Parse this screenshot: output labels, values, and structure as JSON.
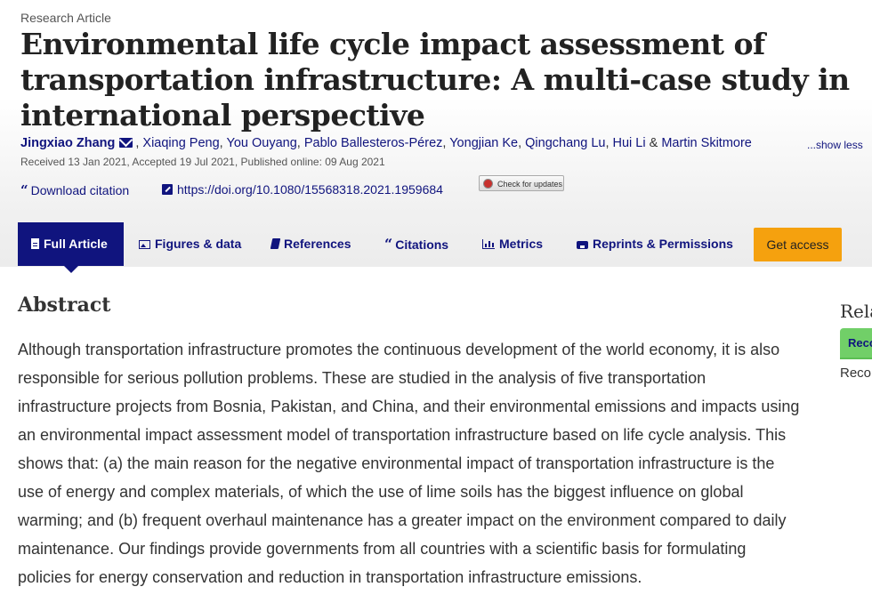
{
  "article": {
    "type": "Research Article",
    "title": "Environmental life cycle impact assessment of transportation infrastructure: A multi-case study in international perspective",
    "authors": [
      "Jingxiao Zhang",
      "Xiaqing Peng",
      "You Ouyang",
      "Pablo Ballesteros-Pérez",
      "Yongjian Ke",
      "Qingchang Lu",
      "Hui Li",
      "Martin Skitmore"
    ],
    "author_separator": ",",
    "author_last_separator": "&",
    "show_less": "...show less",
    "dates": "Received 13 Jan 2021, Accepted 19 Jul 2021, Published online: 09 Aug 2021"
  },
  "links": {
    "download_citation": "Download citation",
    "doi": "https://doi.org/10.1080/15568318.2021.1959684",
    "check_updates": "Check for updates"
  },
  "tabs": [
    {
      "label": "Full Article",
      "icon": "document-icon",
      "active": true
    },
    {
      "label": "Figures & data",
      "icon": "image-icon",
      "active": false
    },
    {
      "label": "References",
      "icon": "book-icon",
      "active": false
    },
    {
      "label": "Citations",
      "icon": "quote-icon",
      "active": false
    },
    {
      "label": "Metrics",
      "icon": "bar-chart-icon",
      "active": false
    },
    {
      "label": "Reprints & Permissions",
      "icon": "print-icon",
      "active": false
    }
  ],
  "get_access": "Get access",
  "abstract": {
    "heading": "Abstract",
    "text": "Although transportation infrastructure promotes the continuous development of the world economy, it is also responsible for serious pollution problems. These are studied in the analysis of five transportation infrastructure projects from Bosnia, Pakistan, and China, and their environmental emissions and impacts using an environmental impact assessment model of transportation infrastructure based on life cycle analysis. This shows that: (a) the main reason for the negative environmental impact of transportation infrastructure is the use of energy and complex materials, of which the use of lime soils has the biggest influence on global warming; and (b) frequent overhaul maintenance has a greater impact on the environment compared to daily maintenance. Our findings provide governments from all countries with a scientific basis for formulating policies for energy conservation and reduction in transportation infrastructure emissions."
  },
  "sidebar": {
    "heading": "Rela",
    "tab": "Reco",
    "text": "Reco"
  },
  "colors": {
    "brand": "#10147e",
    "access": "#f5a10e",
    "recommend_tab": "#71cf68"
  }
}
